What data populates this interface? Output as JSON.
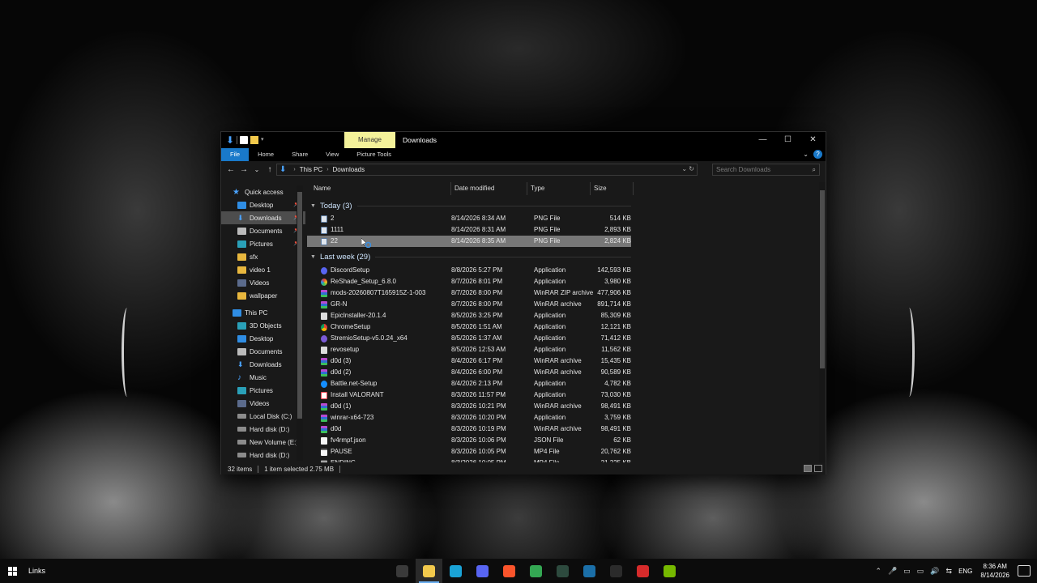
{
  "window": {
    "title": "Downloads",
    "manage_tab": "Manage",
    "controls": {
      "minimize": "—",
      "maximize": "☐",
      "close": "✕"
    }
  },
  "ribbon": {
    "tabs": [
      "File",
      "Home",
      "Share",
      "View",
      "Picture Tools"
    ],
    "help": "?"
  },
  "nav_buttons": {
    "back": "←",
    "forward": "→",
    "recent": "⌄",
    "up": "↑"
  },
  "address": {
    "crumbs": [
      "This PC",
      "Downloads"
    ],
    "search_placeholder": "Search Downloads"
  },
  "navpane": {
    "quick_access": "Quick access",
    "quick_items": [
      {
        "label": "Desktop",
        "icon": "desktop-icon",
        "pinned": true
      },
      {
        "label": "Downloads",
        "icon": "downloads-icon",
        "pinned": true,
        "selected": true
      },
      {
        "label": "Documents",
        "icon": "documents-icon",
        "pinned": true
      },
      {
        "label": "Pictures",
        "icon": "pictures-icon",
        "pinned": true
      },
      {
        "label": "sfx",
        "icon": "folder-icon"
      },
      {
        "label": "video 1",
        "icon": "folder-icon"
      },
      {
        "label": "Videos",
        "icon": "videos-icon"
      },
      {
        "label": "wallpaper",
        "icon": "folder-icon"
      }
    ],
    "this_pc": "This PC",
    "pc_items": [
      {
        "label": "3D Objects",
        "icon": "3d-objects-icon"
      },
      {
        "label": "Desktop",
        "icon": "desktop-icon"
      },
      {
        "label": "Documents",
        "icon": "documents-icon"
      },
      {
        "label": "Downloads",
        "icon": "downloads-icon"
      },
      {
        "label": "Music",
        "icon": "music-icon"
      },
      {
        "label": "Pictures",
        "icon": "pictures-icon"
      },
      {
        "label": "Videos",
        "icon": "videos-icon"
      },
      {
        "label": "Local Disk (C:)",
        "icon": "drive-icon"
      },
      {
        "label": "Hard disk (D:)",
        "icon": "drive-icon"
      },
      {
        "label": "New Volume (E:)",
        "icon": "drive-icon"
      },
      {
        "label": "Hard disk (D:)",
        "icon": "drive-icon"
      }
    ]
  },
  "columns": {
    "name": "Name",
    "date": "Date modified",
    "type": "Type",
    "size": "Size"
  },
  "groups": {
    "today": "Today (3)",
    "last_week": "Last week (29)"
  },
  "files_today": [
    {
      "name": "2",
      "date": "8/14/2026 8:34 AM",
      "type": "PNG File",
      "size": "514 KB",
      "icon": "png"
    },
    {
      "name": "1111",
      "date": "8/14/2026 8:31 AM",
      "type": "PNG File",
      "size": "2,893 KB",
      "icon": "png"
    },
    {
      "name": "22",
      "date": "8/14/2026 8:35 AM",
      "type": "PNG File",
      "size": "2,824 KB",
      "icon": "png",
      "selected": true
    }
  ],
  "files_last_week": [
    {
      "name": "DiscordSetup",
      "date": "8/8/2026 5:27 PM",
      "type": "Application",
      "size": "142,593 KB",
      "icon": "app"
    },
    {
      "name": "ReShade_Setup_6.8.0",
      "date": "8/7/2026 8:01 PM",
      "type": "Application",
      "size": "3,980 KB",
      "icon": "reshade"
    },
    {
      "name": "mods-20260807T165915Z-1-003",
      "date": "8/7/2026 8:00 PM",
      "type": "WinRAR ZIP archive",
      "size": "477,906 KB",
      "icon": "rar"
    },
    {
      "name": "GR-N",
      "date": "8/7/2026 8:00 PM",
      "type": "WinRAR archive",
      "size": "891,714 KB",
      "icon": "rar"
    },
    {
      "name": "EpicInstaller-20.1.4",
      "date": "8/5/2026 3:25 PM",
      "type": "Application",
      "size": "85,309 KB",
      "icon": "epic"
    },
    {
      "name": "ChromeSetup",
      "date": "8/5/2026 1:51 AM",
      "type": "Application",
      "size": "12,121 KB",
      "icon": "chrome"
    },
    {
      "name": "StremioSetup-v5.0.24_x64",
      "date": "8/5/2026 1:37 AM",
      "type": "Application",
      "size": "71,412 KB",
      "icon": "stremio"
    },
    {
      "name": "revosetup",
      "date": "8/5/2026 12:53 AM",
      "type": "Application",
      "size": "11,562 KB",
      "icon": "epic"
    },
    {
      "name": "d0d (3)",
      "date": "8/4/2026 6:17 PM",
      "type": "WinRAR archive",
      "size": "15,435 KB",
      "icon": "rar"
    },
    {
      "name": "d0d (2)",
      "date": "8/4/2026 6:00 PM",
      "type": "WinRAR archive",
      "size": "90,589 KB",
      "icon": "rar"
    },
    {
      "name": "Battle.net-Setup",
      "date": "8/4/2026 2:13 PM",
      "type": "Application",
      "size": "4,782 KB",
      "icon": "bnet"
    },
    {
      "name": "Install VALORANT",
      "date": "8/3/2026 11:57 PM",
      "type": "Application",
      "size": "73,030 KB",
      "icon": "val"
    },
    {
      "name": "d0d (1)",
      "date": "8/3/2026 10:21 PM",
      "type": "WinRAR archive",
      "size": "98,491 KB",
      "icon": "rar"
    },
    {
      "name": "winrar-x64-723",
      "date": "8/3/2026 10:20 PM",
      "type": "Application",
      "size": "3,759 KB",
      "icon": "rar"
    },
    {
      "name": "d0d",
      "date": "8/3/2026 10:19 PM",
      "type": "WinRAR archive",
      "size": "98,491 KB",
      "icon": "rar"
    },
    {
      "name": "fv4rmpf.json",
      "date": "8/3/2026 10:06 PM",
      "type": "JSON File",
      "size": "62 KB",
      "icon": "json"
    },
    {
      "name": "PAUSE",
      "date": "8/3/2026 10:05 PM",
      "type": "MP4 File",
      "size": "20,762 KB",
      "icon": "mp4"
    },
    {
      "name": "ENDING",
      "date": "8/3/2026 10:05 PM",
      "type": "MP4 File",
      "size": "21,225 KB",
      "icon": "mp4"
    }
  ],
  "status": {
    "items": "32 items",
    "selected": "1 item selected  2.75 MB"
  },
  "taskbar": {
    "links": "Links",
    "apps": [
      {
        "name": "store-icon",
        "color": "#3a3a3a",
        "active": false
      },
      {
        "name": "file-explorer-icon",
        "color": "#f2c94c",
        "active": true
      },
      {
        "name": "edge-icon",
        "color": "#1aa3d6",
        "active": false
      },
      {
        "name": "discord-icon",
        "color": "#5865f2",
        "active": false
      },
      {
        "name": "brave-icon",
        "color": "#fb542b",
        "active": false
      },
      {
        "name": "chrome-icon",
        "color": "#34a853",
        "active": false
      },
      {
        "name": "xbox-icon",
        "color": "#2d4a3e",
        "active": false
      },
      {
        "name": "steam-icon",
        "color": "#1b6fa8",
        "active": false
      },
      {
        "name": "epic-icon",
        "color": "#2b2b2b",
        "active": false
      },
      {
        "name": "recorder-icon",
        "color": "#d62b2b",
        "active": false
      },
      {
        "name": "nvidia-icon",
        "color": "#76b900",
        "active": false
      }
    ],
    "lang": "ENG",
    "time": "8:36 AM",
    "date": "8/14/2026"
  }
}
